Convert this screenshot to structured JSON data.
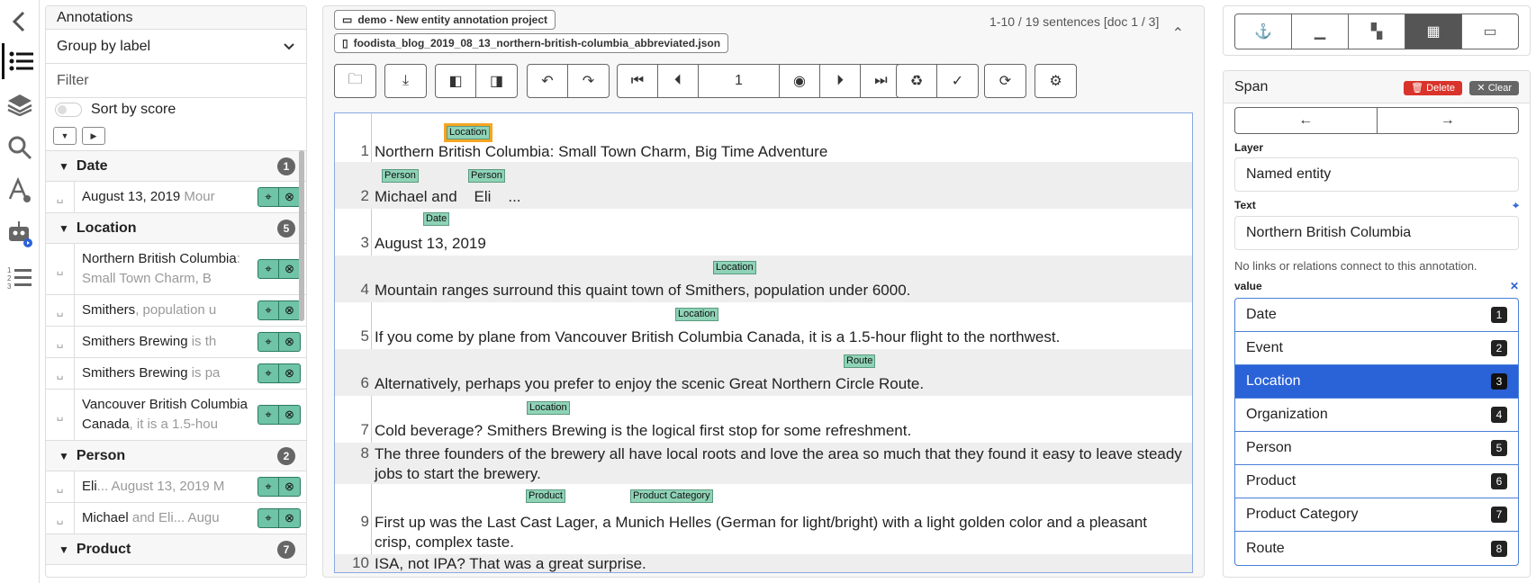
{
  "annotations_panel": {
    "title": "Annotations",
    "group_by": "Group by label",
    "filter_placeholder": "Filter",
    "sort_label": "Sort by score",
    "groups": [
      {
        "label": "Date",
        "count": "1",
        "items": [
          {
            "main": "August 13, 2019",
            "muted": " Mour"
          }
        ]
      },
      {
        "label": "Location",
        "count": "5",
        "items": [
          {
            "main": "Northern British Columbia",
            "muted": ": Small Town Charm, B"
          },
          {
            "main": "Smithers",
            "muted": ", population u"
          },
          {
            "main": "Smithers Brewing",
            "muted": " is th"
          },
          {
            "main": "Smithers Brewing",
            "muted": " is pa"
          },
          {
            "main": "Vancouver British Columbia Canada",
            "muted": ", it is a 1.5-hou"
          }
        ]
      },
      {
        "label": "Person",
        "count": "2",
        "items": [
          {
            "main": "Eli",
            "muted": "... August 13, 2019 M"
          },
          {
            "main": "Michael",
            "muted": " and Eli... Augu"
          }
        ]
      },
      {
        "label": "Product",
        "count": "7",
        "items": []
      }
    ]
  },
  "header": {
    "project": "demo - New entity annotation project",
    "document": "foodista_blog_2019_08_13_northern-british-columbia_abbreviated.json",
    "pager": "1-10 / 19 sentences [doc 1 / 3]",
    "page_value": "1"
  },
  "sentences": [
    {
      "n": "1",
      "text": "Northern British Columbia: Small Town Charm, Big Time Adventure"
    },
    {
      "n": "2",
      "text": "Michael and    Eli    ..."
    },
    {
      "n": "3",
      "text": "August 13, 2019"
    },
    {
      "n": "4",
      "text": "Mountain ranges surround this quaint town of Smithers, population under 6000."
    },
    {
      "n": "5",
      "text": "If you come by plane from Vancouver British Columbia Canada, it is a 1.5-hour flight to the northwest."
    },
    {
      "n": "6",
      "text": "Alternatively, perhaps you prefer to enjoy the scenic Great Northern Circle Route."
    },
    {
      "n": "7",
      "text": "Cold beverage? Smithers Brewing is the logical first stop for some refreshment."
    },
    {
      "n": "8",
      "text": "The three founders of the brewery all have local roots and love the area so much that they found it easy to leave steady jobs to start the brewery."
    },
    {
      "n": "9",
      "text": "First up was the Last Cast Lager, a Munich Helles (German for light/bright) with a light golden color and a pleasant crisp, complex taste."
    },
    {
      "n": "10",
      "text": "ISA, not IPA? That was a great surprise."
    }
  ],
  "labels": {
    "l1": "Location",
    "l2a": "Person",
    "l2b": "Person",
    "l3": "Date",
    "l4": "Location",
    "l5": "Location",
    "l6": "Route",
    "l7": "Location",
    "l9a": "Product",
    "l9b": "Product Category"
  },
  "span_panel": {
    "title": "Span",
    "delete": "Delete",
    "clear": "Clear",
    "layer_label": "Layer",
    "layer_value": "Named entity",
    "text_label": "Text",
    "text_value": "Northern British Columbia",
    "note": "No links or relations connect to this annotation.",
    "value_label": "value",
    "values": [
      {
        "name": "Date",
        "key": "1"
      },
      {
        "name": "Event",
        "key": "2"
      },
      {
        "name": "Location",
        "key": "3"
      },
      {
        "name": "Organization",
        "key": "4"
      },
      {
        "name": "Person",
        "key": "5"
      },
      {
        "name": "Product",
        "key": "6"
      },
      {
        "name": "Product Category",
        "key": "7"
      },
      {
        "name": "Route",
        "key": "8"
      }
    ],
    "selected_value": "Location"
  }
}
